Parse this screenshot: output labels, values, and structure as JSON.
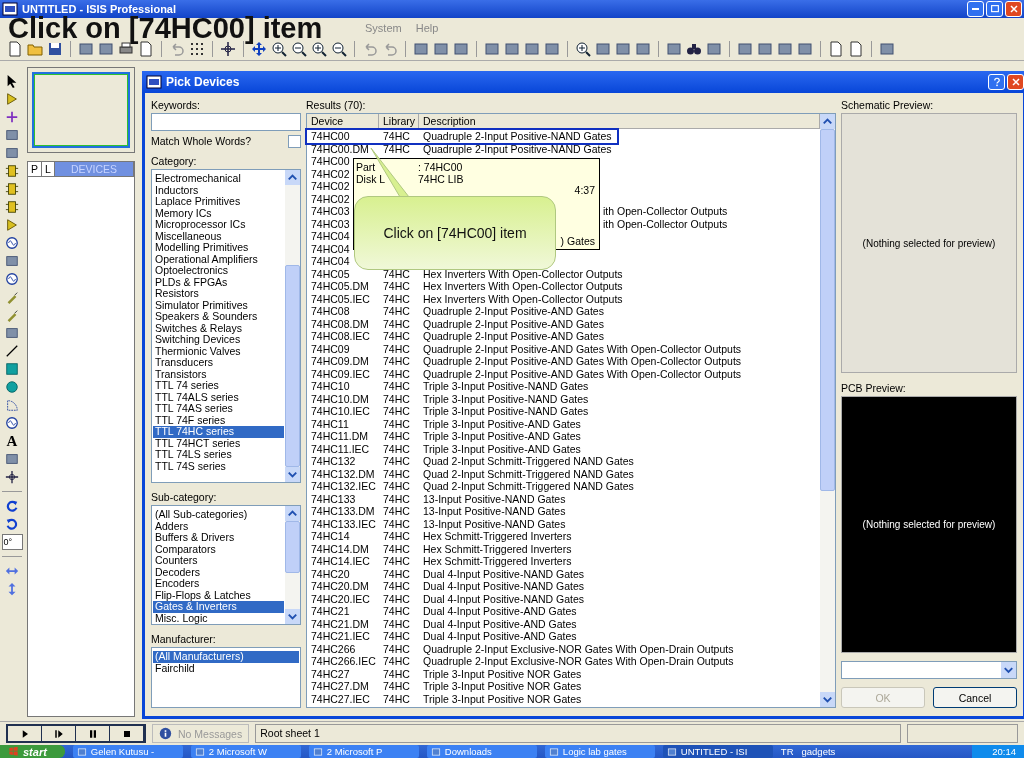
{
  "app": {
    "title": "UNTITLED - ISIS Professional",
    "menu": [
      "System",
      "Help"
    ]
  },
  "caption": "Click on [74HC00] item",
  "left_panel": {
    "tabs": [
      {
        "label": "P",
        "selected": false
      },
      {
        "label": "L",
        "selected": false
      },
      {
        "label": "DEVICES",
        "selected": true
      }
    ],
    "text_tool": "A",
    "rotation": "0°"
  },
  "dialog": {
    "title": "Pick Devices",
    "keywords_label": "Keywords:",
    "match_label": "Match Whole Words?",
    "match_checked": false,
    "category": {
      "label": "Category:",
      "items": [
        {
          "label": "Electromechanical",
          "selected": false
        },
        {
          "label": "Inductors",
          "selected": false
        },
        {
          "label": "Laplace Primitives",
          "selected": false
        },
        {
          "label": "Memory ICs",
          "selected": false
        },
        {
          "label": "Microprocessor ICs",
          "selected": false
        },
        {
          "label": "Miscellaneous",
          "selected": false
        },
        {
          "label": "Modelling Primitives",
          "selected": false
        },
        {
          "label": "Operational Amplifiers",
          "selected": false
        },
        {
          "label": "Optoelectronics",
          "selected": false
        },
        {
          "label": "PLDs & FPGAs",
          "selected": false
        },
        {
          "label": "Resistors",
          "selected": false
        },
        {
          "label": "Simulator Primitives",
          "selected": false
        },
        {
          "label": "Speakers & Sounders",
          "selected": false
        },
        {
          "label": "Switches & Relays",
          "selected": false
        },
        {
          "label": "Switching Devices",
          "selected": false
        },
        {
          "label": "Thermionic Valves",
          "selected": false
        },
        {
          "label": "Transducers",
          "selected": false
        },
        {
          "label": "Transistors",
          "selected": false
        },
        {
          "label": "TTL 74 series",
          "selected": false
        },
        {
          "label": "TTL 74ALS series",
          "selected": false
        },
        {
          "label": "TTL 74AS series",
          "selected": false
        },
        {
          "label": "TTL 74F series",
          "selected": false
        },
        {
          "label": "TTL 74HC series",
          "selected": true
        },
        {
          "label": "TTL 74HCT series",
          "selected": false
        },
        {
          "label": "TTL 74LS series",
          "selected": false
        },
        {
          "label": "TTL 74S series",
          "selected": false
        }
      ]
    },
    "sub_category": {
      "label": "Sub-category:",
      "items": [
        {
          "label": "(All Sub-categories)",
          "selected": false
        },
        {
          "label": "Adders",
          "selected": false
        },
        {
          "label": "Buffers & Drivers",
          "selected": false
        },
        {
          "label": "Comparators",
          "selected": false
        },
        {
          "label": "Counters",
          "selected": false
        },
        {
          "label": "Decoders",
          "selected": false
        },
        {
          "label": "Encoders",
          "selected": false
        },
        {
          "label": "Flip-Flops & Latches",
          "selected": false
        },
        {
          "label": "Gates & Inverters",
          "selected": true
        },
        {
          "label": "Misc. Logic",
          "selected": false
        }
      ]
    },
    "manufacturer": {
      "label": "Manufacturer:",
      "items": [
        {
          "label": "(All Manufacturers)",
          "selected": true
        },
        {
          "label": "Fairchild",
          "selected": false
        }
      ]
    },
    "results": {
      "label": "Results (70):",
      "columns": [
        "Device",
        "Library",
        "Description"
      ],
      "rows": [
        {
          "device": "74HC00",
          "library": "74HC",
          "description": "Quadruple 2-Input Positive-NAND Gates",
          "highlighted": true
        },
        {
          "device": "74HC00.DM",
          "library": "74HC",
          "description": "Quadruple 2-Input Positive-NAND Gates"
        },
        {
          "device": "74HC00"
        },
        {
          "device": "74HC02"
        },
        {
          "device": "74HC02"
        },
        {
          "device": "74HC02"
        },
        {
          "device": "74HC03",
          "description": "ith Open-Collector Outputs"
        },
        {
          "device": "74HC03",
          "description": "ith Open-Collector Outputs"
        },
        {
          "device": "74HC04"
        },
        {
          "device": "74HC04"
        },
        {
          "device": "74HC04"
        },
        {
          "device": "74HC05",
          "library": "74HC",
          "description": "Hex Inverters With Open-Collector Outputs"
        },
        {
          "device": "74HC05.DM",
          "library": "74HC",
          "description": "Hex Inverters With Open-Collector Outputs"
        },
        {
          "device": "74HC05.IEC",
          "library": "74HC",
          "description": "Hex Inverters With Open-Collector Outputs"
        },
        {
          "device": "74HC08",
          "library": "74HC",
          "description": "Quadruple 2-Input Positive-AND Gates"
        },
        {
          "device": "74HC08.DM",
          "library": "74HC",
          "description": "Quadruple 2-Input Positive-AND Gates"
        },
        {
          "device": "74HC08.IEC",
          "library": "74HC",
          "description": "Quadruple 2-Input Positive-AND Gates"
        },
        {
          "device": "74HC09",
          "library": "74HC",
          "description": "Quadruple 2-Input Positive-AND Gates With Open-Collector Outputs"
        },
        {
          "device": "74HC09.DM",
          "library": "74HC",
          "description": "Quadruple 2-Input Positive-AND Gates With Open-Collector Outputs"
        },
        {
          "device": "74HC09.IEC",
          "library": "74HC",
          "description": "Quadruple 2-Input Positive-AND Gates With Open-Collector Outputs"
        },
        {
          "device": "74HC10",
          "library": "74HC",
          "description": "Triple 3-Input Positive-NAND Gates"
        },
        {
          "device": "74HC10.DM",
          "library": "74HC",
          "description": "Triple 3-Input Positive-NAND Gates"
        },
        {
          "device": "74HC10.IEC",
          "library": "74HC",
          "description": "Triple 3-Input Positive-NAND Gates"
        },
        {
          "device": "74HC11",
          "library": "74HC",
          "description": "Triple 3-Input Positive-AND Gates"
        },
        {
          "device": "74HC11.DM",
          "library": "74HC",
          "description": "Triple 3-Input Positive-AND Gates"
        },
        {
          "device": "74HC11.IEC",
          "library": "74HC",
          "description": "Triple 3-Input Positive-AND Gates"
        },
        {
          "device": "74HC132",
          "library": "74HC",
          "description": "Quad 2-Input Schmitt-Triggered NAND Gates"
        },
        {
          "device": "74HC132.DM",
          "library": "74HC",
          "description": "Quad 2-Input Schmitt-Triggered NAND Gates"
        },
        {
          "device": "74HC132.IEC",
          "library": "74HC",
          "description": "Quad 2-Input Schmitt-Triggered NAND Gates"
        },
        {
          "device": "74HC133",
          "library": "74HC",
          "description": "13-Input Positive-NAND Gates"
        },
        {
          "device": "74HC133.DM",
          "library": "74HC",
          "description": "13-Input Positive-NAND Gates"
        },
        {
          "device": "74HC133.IEC",
          "library": "74HC",
          "description": "13-Input Positive-NAND Gates"
        },
        {
          "device": "74HC14",
          "library": "74HC",
          "description": "Hex Schmitt-Triggered Inverters"
        },
        {
          "device": "74HC14.DM",
          "library": "74HC",
          "description": "Hex Schmitt-Triggered Inverters"
        },
        {
          "device": "74HC14.IEC",
          "library": "74HC",
          "description": "Hex Schmitt-Triggered Inverters"
        },
        {
          "device": "74HC20",
          "library": "74HC",
          "description": "Dual 4-Input Positive-NAND Gates"
        },
        {
          "device": "74HC20.DM",
          "library": "74HC",
          "description": "Dual 4-Input Positive-NAND Gates"
        },
        {
          "device": "74HC20.IEC",
          "library": "74HC",
          "description": "Dual 4-Input Positive-NAND Gates"
        },
        {
          "device": "74HC21",
          "library": "74HC",
          "description": "Dual 4-Input Positive-AND Gates"
        },
        {
          "device": "74HC21.DM",
          "library": "74HC",
          "description": "Dual 4-Input Positive-AND Gates"
        },
        {
          "device": "74HC21.IEC",
          "library": "74HC",
          "description": "Dual 4-Input Positive-AND Gates"
        },
        {
          "device": "74HC266",
          "library": "74HC",
          "description": "Quadruple 2-Input Exclusive-NOR Gates With Open-Drain Outputs"
        },
        {
          "device": "74HC266.IEC",
          "library": "74HC",
          "description": "Quadruple 2-Input Exclusive-NOR Gates With Open-Drain Outputs"
        },
        {
          "device": "74HC27",
          "library": "74HC",
          "description": "Triple 3-Input Positive NOR Gates"
        },
        {
          "device": "74HC27.DM",
          "library": "74HC",
          "description": "Triple 3-Input Positive NOR Gates"
        },
        {
          "device": "74HC27.IEC",
          "library": "74HC",
          "description": "Triple 3-Input Positive NOR Gates"
        }
      ]
    },
    "tooltip": [
      {
        "key": "Part",
        "value": ": 74HC00"
      },
      {
        "key": "Disk L",
        "value": "74HC LIB"
      },
      {
        "value": "4:37"
      },
      {
        "value": ") Gates"
      }
    ],
    "schematic_preview": {
      "label": "Schematic Preview:",
      "message": "(Nothing selected for preview)"
    },
    "pcb_preview": {
      "label": "PCB Preview:",
      "message": "(Nothing selected for preview)"
    },
    "buttons": [
      {
        "label": "OK",
        "disabled": true
      },
      {
        "label": "Cancel",
        "disabled": false
      }
    ]
  },
  "callout": "Click on [74HC00] item",
  "status_bar": {
    "message": "No Messages",
    "sheet": "Root sheet 1"
  },
  "taskbar": {
    "start": "start",
    "items": [
      "Gelen Kutusu -",
      "2 Microsoft W",
      "2 Microsoft P",
      "Downloads",
      "Logic lab gates",
      "UNTITLED - ISI"
    ],
    "language": "TR",
    "toolbar": "gadgets",
    "clock": "20:14"
  }
}
